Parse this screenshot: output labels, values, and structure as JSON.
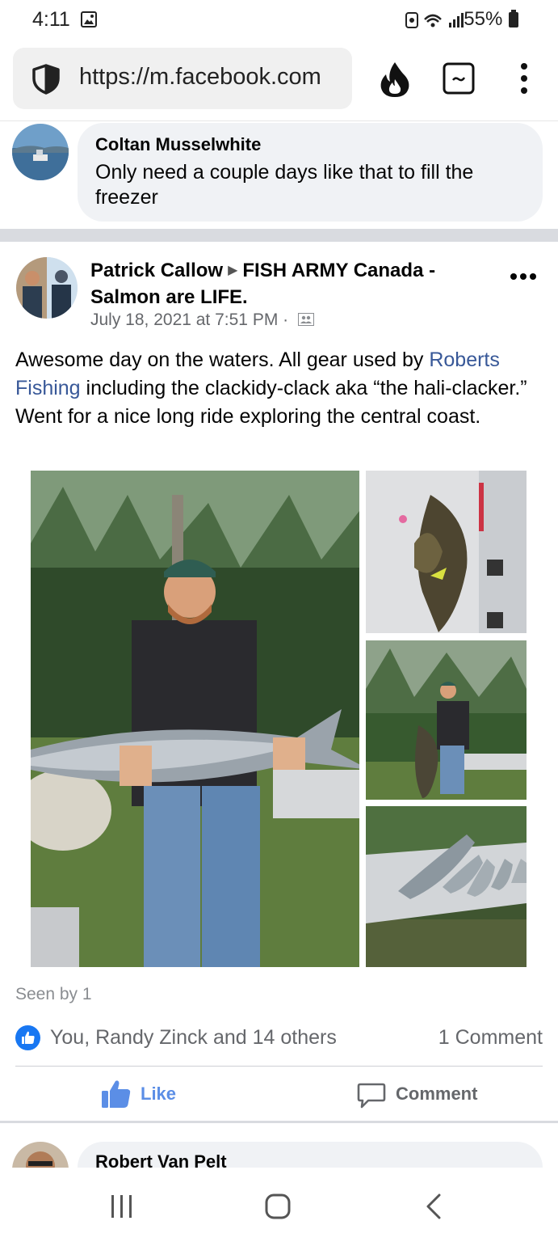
{
  "status_bar": {
    "time": "4:11",
    "battery": "55%"
  },
  "browser": {
    "url": "https://m.facebook.com",
    "icons": [
      "shield-icon",
      "flame-icon",
      "tab-switcher-icon",
      "overflow-menu-icon"
    ]
  },
  "top_comment": {
    "author": "Coltan Musselwhite",
    "text": "Only need a couple days like that to fill the freezer"
  },
  "post": {
    "author": "Patrick Callow",
    "group": "FISH ARMY Canada - Salmon are LIFE.",
    "timestamp": "July 18, 2021 at 7:51 PM",
    "meta_separator": "·",
    "text_before_link": "Awesome day on the waters. All gear used by ",
    "link_text": "Roberts Fishing",
    "text_after_link": " including the clackidy-clack aka “the hali-clacker.” Went for a nice long ride exploring the central coast.",
    "seen_by": "Seen by 1",
    "reactions_text": "You, Randy Zinck and 14 others",
    "comments_count": "1 Comment",
    "like_label": "Like",
    "comment_label": "Comment"
  },
  "next_comment": {
    "author": "Robert Van Pelt"
  },
  "colors": {
    "facebook_blue": "#1877f2",
    "link": "#385898",
    "secondary_text": "#65676b",
    "bubble_bg": "#f0f2f5"
  }
}
